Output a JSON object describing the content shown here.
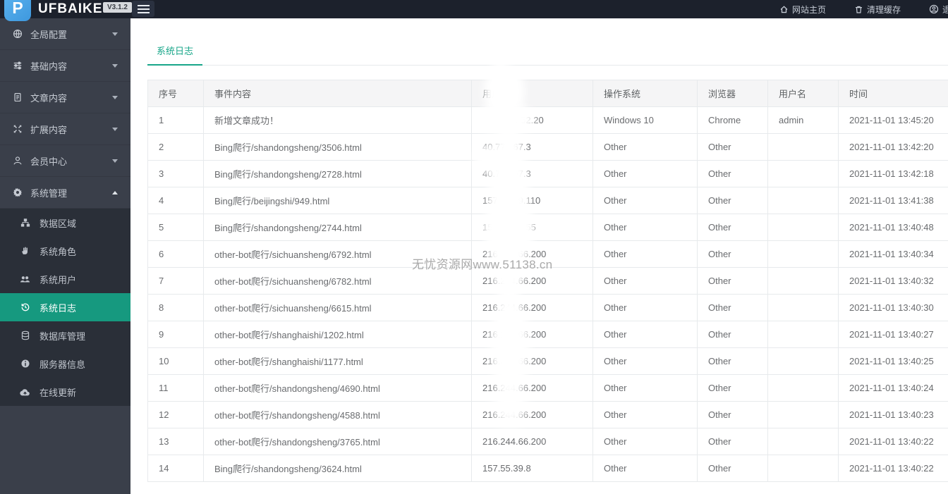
{
  "topbar": {
    "logo_letter": "P",
    "logo_text": "UFBAIKE",
    "version_badge": "V3.1.2",
    "menu": [
      {
        "label": "网站主页",
        "icon": "home-icon"
      },
      {
        "label": "清理缓存",
        "icon": "trash-icon"
      },
      {
        "label": "退出",
        "icon": "user-circle-icon"
      }
    ]
  },
  "sidebar": {
    "items": [
      {
        "label": "全局配置",
        "icon": "globe-icon",
        "state": "collapsed"
      },
      {
        "label": "基础内容",
        "icon": "sliders-icon",
        "state": "collapsed"
      },
      {
        "label": "文章内容",
        "icon": "document-icon",
        "state": "collapsed"
      },
      {
        "label": "扩展内容",
        "icon": "expand-icon",
        "state": "collapsed"
      },
      {
        "label": "会员中心",
        "icon": "user-icon",
        "state": "collapsed"
      },
      {
        "label": "系统管理",
        "icon": "gear-icon",
        "state": "expanded"
      }
    ],
    "submenu": [
      {
        "label": "数据区域",
        "icon": "sitemap-icon",
        "active": false
      },
      {
        "label": "系统角色",
        "icon": "hand-icon",
        "active": false
      },
      {
        "label": "系统用户",
        "icon": "users-icon",
        "active": false
      },
      {
        "label": "系统日志",
        "icon": "history-icon",
        "active": true
      },
      {
        "label": "数据库管理",
        "icon": "database-icon",
        "active": false
      },
      {
        "label": "服务器信息",
        "icon": "info-icon",
        "active": false
      },
      {
        "label": "在线更新",
        "icon": "cloud-icon",
        "active": false
      }
    ]
  },
  "main": {
    "tab": "系统日志",
    "watermark": "无忧资源网www.51138.cn",
    "table": {
      "columns": [
        "序号",
        "事件内容",
        "用户IP",
        "操作系统",
        "浏览器",
        "用户名",
        "时间"
      ],
      "rows": [
        [
          "1",
          "新增文章成功！",
          "             252.20",
          "Windows 10",
          "Chrome",
          "admin",
          "2021-11-01 13:45:20"
        ],
        [
          "2",
          "Bing爬行/shandongsheng/3506.html",
          "40.77.167.3",
          "Other",
          "Other",
          "",
          "2021-11-01 13:42:20"
        ],
        [
          "3",
          "Bing爬行/shandongsheng/2728.html",
          "40.77.167.3",
          "Other",
          "Other",
          "",
          "2021-11-01 13:42:18"
        ],
        [
          "4",
          "Bing爬行/beijingshi/949.html",
          "157.55.39.110",
          "Other",
          "Other",
          "",
          "2021-11-01 13:41:38"
        ],
        [
          "5",
          "Bing爬行/shandongsheng/2744.html",
          "157.55.39.55",
          "Other",
          "Other",
          "",
          "2021-11-01 13:40:48"
        ],
        [
          "6",
          "other-bot爬行/sichuansheng/6792.html",
          "216.244.66.200",
          "Other",
          "Other",
          "",
          "2021-11-01 13:40:34"
        ],
        [
          "7",
          "other-bot爬行/sichuansheng/6782.html",
          "216.244.66.200",
          "Other",
          "Other",
          "",
          "2021-11-01 13:40:32"
        ],
        [
          "8",
          "other-bot爬行/sichuansheng/6615.html",
          "216.244.66.200",
          "Other",
          "Other",
          "",
          "2021-11-01 13:40:30"
        ],
        [
          "9",
          "other-bot爬行/shanghaishi/1202.html",
          "216.244.66.200",
          "Other",
          "Other",
          "",
          "2021-11-01 13:40:27"
        ],
        [
          "10",
          "other-bot爬行/shanghaishi/1177.html",
          "216.244.66.200",
          "Other",
          "Other",
          "",
          "2021-11-01 13:40:25"
        ],
        [
          "11",
          "other-bot爬行/shandongsheng/4690.html",
          "216.244.66.200",
          "Other",
          "Other",
          "",
          "2021-11-01 13:40:24"
        ],
        [
          "12",
          "other-bot爬行/shandongsheng/4588.html",
          "216.244.66.200",
          "Other",
          "Other",
          "",
          "2021-11-01 13:40:23"
        ],
        [
          "13",
          "other-bot爬行/shandongsheng/3765.html",
          "216.244.66.200",
          "Other",
          "Other",
          "",
          "2021-11-01 13:40:22"
        ],
        [
          "14",
          "Bing爬行/shandongsheng/3624.html",
          "157.55.39.8",
          "Other",
          "Other",
          "",
          "2021-11-01 13:40:22"
        ]
      ]
    }
  },
  "colors": {
    "accent": "#18a689",
    "active_item_bg": "#16997f",
    "topbar_bg": "#1c212c",
    "sidebar_bg": "#3a3f4a",
    "submenu_bg": "#2a2f38",
    "logo_blue": "#459fe2",
    "table_border": "#e7eaec",
    "header_bg": "#f5f5f6"
  }
}
